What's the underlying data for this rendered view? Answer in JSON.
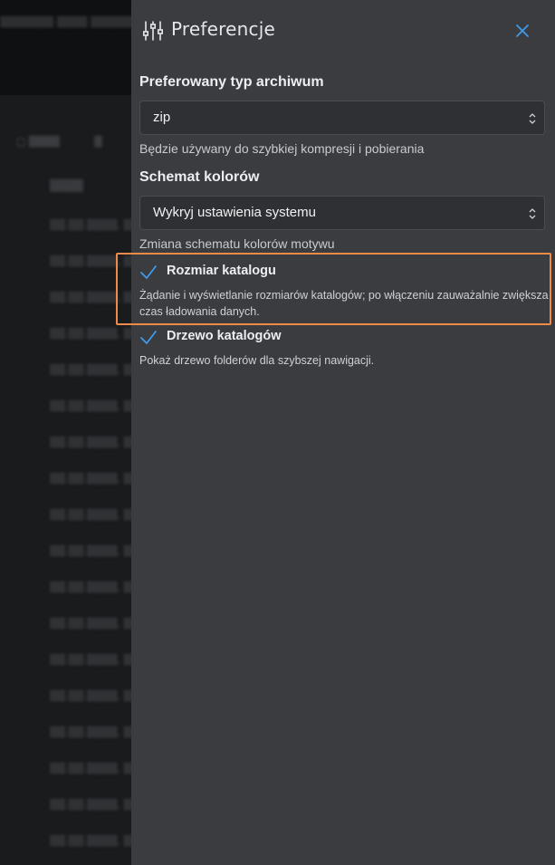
{
  "panel": {
    "title": "Preferencje",
    "close_icon": "close-icon",
    "header_icon": "sliders-icon"
  },
  "archive": {
    "label": "Preferowany typ archiwum",
    "value": "zip",
    "helper": "Będzie używany do szybkiej kompresji i pobierania"
  },
  "color_scheme": {
    "label": "Schemat kolorów",
    "value": "Wykryj ustawienia systemu",
    "helper": "Zmiana schematu kolorów motywu"
  },
  "options": {
    "dir_size": {
      "label": "Rozmiar katalogu",
      "checked": true,
      "description": "Żądanie i wyświetlanie rozmiarów katalogów; po włączeniu zauważalnie zwiększa czas ładowania danych."
    },
    "dir_tree": {
      "label": "Drzewo katalogów",
      "checked": true,
      "description": "Pokaż drzewo folderów dla szybszej nawigacji."
    }
  },
  "colors": {
    "accent": "#3f9be8",
    "highlight": "#f08a4b",
    "panel_bg": "#3b3c40"
  }
}
